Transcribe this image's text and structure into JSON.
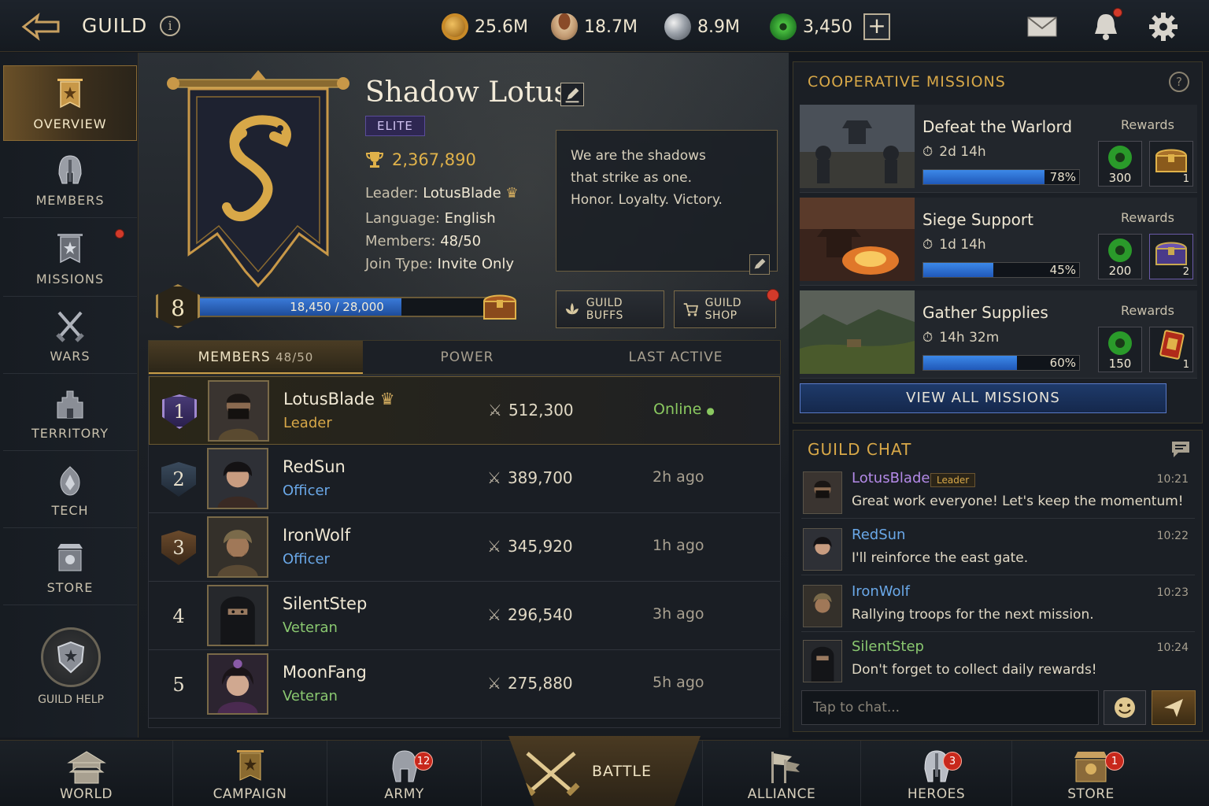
{
  "header": {
    "title": "GUILD",
    "info_label": "i",
    "resources": [
      {
        "name": "gold-coin-icon",
        "value": "25.6M"
      },
      {
        "name": "food-bowl-icon",
        "value": "18.7M"
      },
      {
        "name": "iron-ore-icon",
        "value": "8.9M"
      },
      {
        "name": "jade-icon",
        "value": "3,450"
      }
    ],
    "plus_label": "+",
    "bell_has_notification": true
  },
  "sidebar": {
    "items": [
      {
        "label": "OVERVIEW",
        "icon": "banner-icon",
        "active": true
      },
      {
        "label": "MEMBERS",
        "icon": "helmet-icon",
        "active": false
      },
      {
        "label": "MISSIONS",
        "icon": "mission-banner-icon",
        "active": false,
        "notification": true
      },
      {
        "label": "WARS",
        "icon": "crossed-swords-icon",
        "active": false
      },
      {
        "label": "TERRITORY",
        "icon": "castle-icon",
        "active": false
      },
      {
        "label": "TECH",
        "icon": "tech-crest-icon",
        "active": false
      },
      {
        "label": "STORE",
        "icon": "store-icon",
        "active": false
      }
    ],
    "help_label": "GUILD HELP"
  },
  "guild": {
    "name": "Shadow Lotus",
    "tier": "ELITE",
    "trophies": "2,367,890",
    "leader_label": "Leader:",
    "leader": "LotusBlade",
    "language_label": "Language:",
    "language": "English",
    "members_label": "Members:",
    "members": "48/50",
    "join_label": "Join Type:",
    "join_type": "Invite Only",
    "motto_lines": [
      "We are the shadows",
      "that strike as one.",
      "Honor. Loyalty. Victory."
    ],
    "level": "8",
    "xp_text": "18,450 / 28,000",
    "xp_fraction": 0.659,
    "buffs_label": "GUILD BUFFS",
    "shop_label": "GUILD SHOP"
  },
  "tabs": {
    "members": "MEMBERS",
    "members_count": "48/50",
    "power": "POWER",
    "last_active": "LAST ACTIVE"
  },
  "members": [
    {
      "rank": "1",
      "name": "LotusBlade",
      "role": "Leader",
      "power": "512,300",
      "active": "Online",
      "crown": true
    },
    {
      "rank": "2",
      "name": "RedSun",
      "role": "Officer",
      "power": "389,700",
      "active": "2h ago"
    },
    {
      "rank": "3",
      "name": "IronWolf",
      "role": "Officer",
      "power": "345,920",
      "active": "1h ago"
    },
    {
      "rank": "4",
      "name": "SilentStep",
      "role": "Veteran",
      "power": "296,540",
      "active": "3h ago"
    },
    {
      "rank": "5",
      "name": "MoonFang",
      "role": "Veteran",
      "power": "275,880",
      "active": "5h ago"
    }
  ],
  "coop": {
    "title": "COOPERATIVE MISSIONS",
    "help": "?",
    "rewards_label": "Rewards",
    "missions": [
      {
        "name": "Defeat the Warlord",
        "time": "2d 14h",
        "progress": 0.78,
        "pct": "78%",
        "jade": "300",
        "item": "1",
        "item_icon": "gold-chest-icon"
      },
      {
        "name": "Siege Support",
        "time": "1d 14h",
        "progress": 0.45,
        "pct": "45%",
        "jade": "200",
        "item": "2",
        "item_icon": "purple-chest-icon"
      },
      {
        "name": "Gather Supplies",
        "time": "14h 32m",
        "progress": 0.6,
        "pct": "60%",
        "jade": "150",
        "item": "1",
        "item_icon": "red-scroll-icon"
      }
    ],
    "view_all": "VIEW ALL MISSIONS"
  },
  "chat": {
    "title": "GUILD CHAT",
    "messages": [
      {
        "name": "LotusBlade",
        "tag": "Leader",
        "time": "10:21",
        "text": "Great work everyone! Let's keep the momentum!",
        "color": "#b48ae8"
      },
      {
        "name": "RedSun",
        "tag": "",
        "time": "10:22",
        "text": "I'll reinforce the east gate.",
        "color": "#6aa8e8"
      },
      {
        "name": "IronWolf",
        "tag": "",
        "time": "10:23",
        "text": "Rallying troops for the next mission.",
        "color": "#6aa8e8"
      },
      {
        "name": "SilentStep",
        "tag": "",
        "time": "10:24",
        "text": "Don't forget to collect daily rewards!",
        "color": "#8ac870"
      }
    ],
    "placeholder": "Tap to chat..."
  },
  "nav": {
    "world": "WORLD",
    "campaign": "CAMPAIGN",
    "army": "ARMY",
    "army_badge": "12",
    "battle": "BATTLE",
    "alliance": "ALLIANCE",
    "heroes": "HEROES",
    "heroes_badge": "3",
    "store": "STORE",
    "store_badge": "1"
  }
}
